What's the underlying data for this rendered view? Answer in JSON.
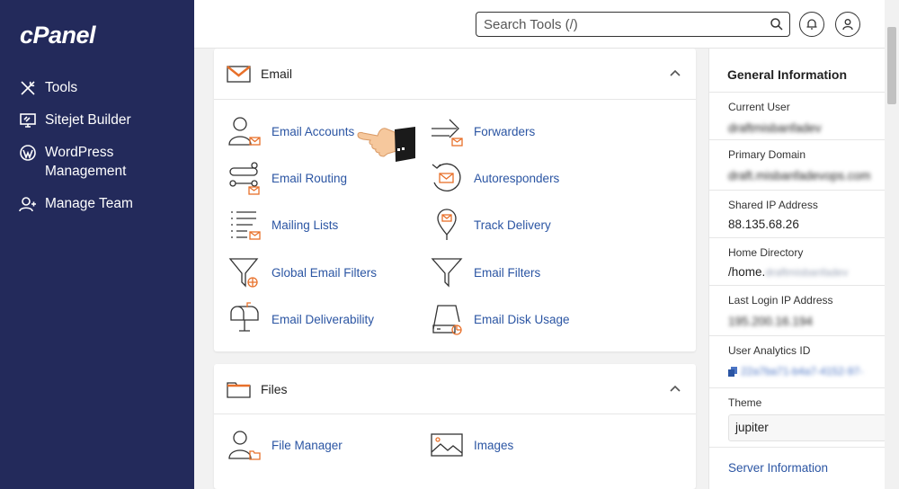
{
  "sidebar": {
    "logo": "cPanel",
    "items": [
      {
        "label": "Tools",
        "icon": "tools-icon"
      },
      {
        "label": "Sitejet Builder",
        "icon": "monitor-icon"
      },
      {
        "label": "WordPress Management",
        "icon": "wordpress-icon"
      },
      {
        "label": "Manage Team",
        "icon": "team-icon"
      }
    ]
  },
  "topbar": {
    "search_placeholder": "Search Tools (/)"
  },
  "email_section": {
    "title": "Email",
    "tools": [
      {
        "label": "Email Accounts",
        "icon": "email-accounts-icon"
      },
      {
        "label": "Forwarders",
        "icon": "forwarders-icon"
      },
      {
        "label": "Email Routing",
        "icon": "email-routing-icon"
      },
      {
        "label": "Autoresponders",
        "icon": "autoresponders-icon"
      },
      {
        "label": "Mailing Lists",
        "icon": "mailing-lists-icon"
      },
      {
        "label": "Track Delivery",
        "icon": "track-delivery-icon"
      },
      {
        "label": "Global Email Filters",
        "icon": "global-filter-icon"
      },
      {
        "label": "Email Filters",
        "icon": "filter-icon"
      },
      {
        "label": "Email Deliverability",
        "icon": "mailbox-icon"
      },
      {
        "label": "Email Disk Usage",
        "icon": "disk-usage-icon"
      }
    ]
  },
  "files_section": {
    "title": "Files",
    "tools": [
      {
        "label": "File Manager",
        "icon": "file-manager-icon"
      },
      {
        "label": "Images",
        "icon": "images-icon"
      }
    ]
  },
  "general_info": {
    "title": "General Information",
    "current_user_label": "Current User",
    "current_user_value": "draftmisbanfadev",
    "primary_domain_label": "Primary Domain",
    "primary_domain_value": "draft.misbanfadevops.com",
    "shared_ip_label": "Shared IP Address",
    "shared_ip_value": "88.135.68.26",
    "home_dir_label": "Home Directory",
    "home_dir_prefix": "/home.",
    "home_dir_blur": "draftmisbanfadev",
    "last_login_label": "Last Login IP Address",
    "last_login_value": "195.200.16.194",
    "analytics_label": "User Analytics ID",
    "analytics_value": "22a7ba71-b4a7-4152-97-",
    "theme_label": "Theme",
    "theme_value": "jupiter",
    "server_info_link": "Server Information"
  },
  "colors": {
    "sidebar_bg": "#232a5b",
    "link": "#2b55a3",
    "accent_orange": "#e8702a"
  }
}
